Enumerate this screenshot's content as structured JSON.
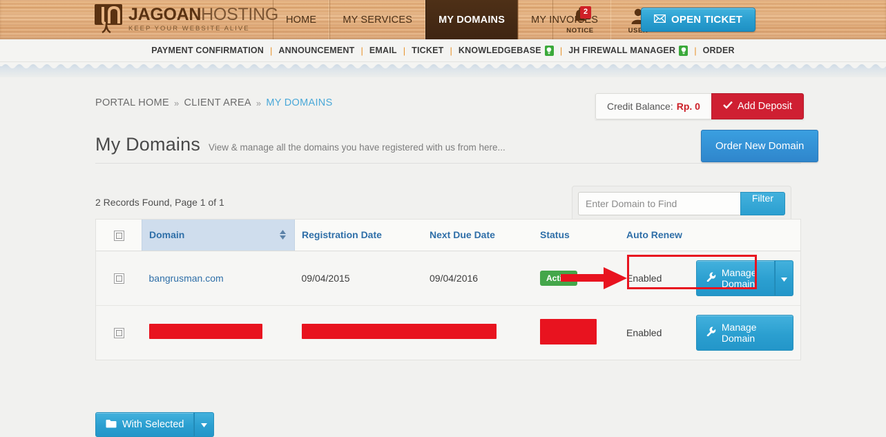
{
  "header": {
    "logo_main_bold": "JAGOAN",
    "logo_main_light": "HOSTING",
    "logo_tagline": "KEEP YOUR WEBSITE ALIVE",
    "nav": [
      {
        "label": "HOME",
        "active": false
      },
      {
        "label": "MY SERVICES",
        "active": false
      },
      {
        "label": "MY DOMAINS",
        "active": true
      },
      {
        "label": "MY INVOICES",
        "active": false
      }
    ],
    "notice": {
      "label": "NOTICE",
      "count": "2"
    },
    "user": {
      "label": "USER"
    },
    "open_ticket_label": "OPEN TICKET"
  },
  "subnav": {
    "items": [
      {
        "label": "PAYMENT CONFIRMATION",
        "badge": false
      },
      {
        "label": "ANNOUNCEMENT",
        "badge": false
      },
      {
        "label": "EMAIL",
        "badge": false
      },
      {
        "label": "TICKET",
        "badge": false
      },
      {
        "label": "KNOWLEDGEBASE",
        "badge": true
      },
      {
        "label": "JH FIREWALL MANAGER",
        "badge": true
      },
      {
        "label": "ORDER",
        "badge": false
      }
    ],
    "separator": "|"
  },
  "breadcrumb": {
    "items": [
      "PORTAL HOME",
      "CLIENT AREA",
      "MY DOMAINS"
    ],
    "separator": "»"
  },
  "credit": {
    "label": "Credit Balance:",
    "amount": "Rp. 0",
    "deposit_label": "Add Deposit"
  },
  "page": {
    "title": "My Domains",
    "subtitle": "View & manage all the domains you have registered with us from here...",
    "order_button": "Order New Domain",
    "records_found": "2 Records Found, Page 1 of 1"
  },
  "filter": {
    "placeholder": "Enter Domain to Find",
    "value": "",
    "button_label": "Filter"
  },
  "table": {
    "columns": [
      "Domain",
      "Registration Date",
      "Next Due Date",
      "Status",
      "Auto Renew"
    ],
    "sorted_column": "Domain",
    "rows": [
      {
        "domain": "bangrusman.com",
        "redacted_domain": false,
        "registration_date": "09/04/2015",
        "redacted_registration": false,
        "next_due_date": "09/04/2016",
        "status": "Active",
        "redacted_status": false,
        "auto_renew": "Enabled",
        "manage_label": "Manage Domain",
        "has_caret": true,
        "highlighted": true
      },
      {
        "domain": "",
        "redacted_domain": true,
        "registration_date": "",
        "redacted_registration": true,
        "next_due_date": "",
        "status": "",
        "redacted_status": true,
        "auto_renew": "Enabled",
        "manage_label": "Manage Domain",
        "has_caret": false,
        "highlighted": false
      }
    ]
  },
  "footer": {
    "with_selected_label": "With Selected"
  },
  "colors": {
    "wood": "#e2ad79",
    "nav_active": "#3f2512",
    "accent_blue": "#2b9fd0",
    "accent_red": "#cf1f32",
    "status_green": "#44a64a",
    "annotation_red": "#e8131f",
    "link_blue": "#2f6fa8",
    "crumb_current": "#4aa8d8"
  }
}
